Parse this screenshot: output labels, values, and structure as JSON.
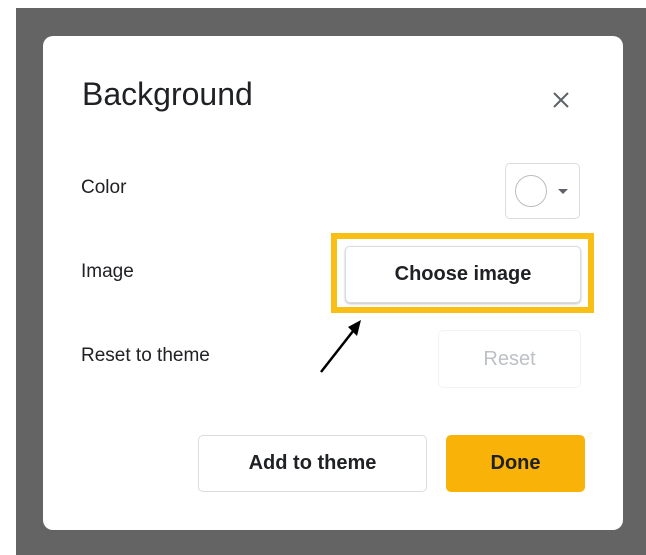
{
  "dialog": {
    "title": "Background",
    "close_icon": "close-icon",
    "rows": {
      "color_label": "Color",
      "image_label": "Image",
      "reset_label": "Reset to theme"
    },
    "color_picker": {
      "selected_color": "#ffffff",
      "icon": "chevron-down-icon"
    },
    "buttons": {
      "choose_image": "Choose image",
      "reset": "Reset",
      "add_to_theme": "Add to theme",
      "done": "Done"
    }
  },
  "annotation": {
    "highlight_color": "#f9bf15",
    "arrow_icon": "arrow-icon"
  },
  "colors": {
    "backdrop": "#646464",
    "done_button": "#f9b308",
    "disabled_text": "#bdc1c6",
    "text": "#202124"
  }
}
